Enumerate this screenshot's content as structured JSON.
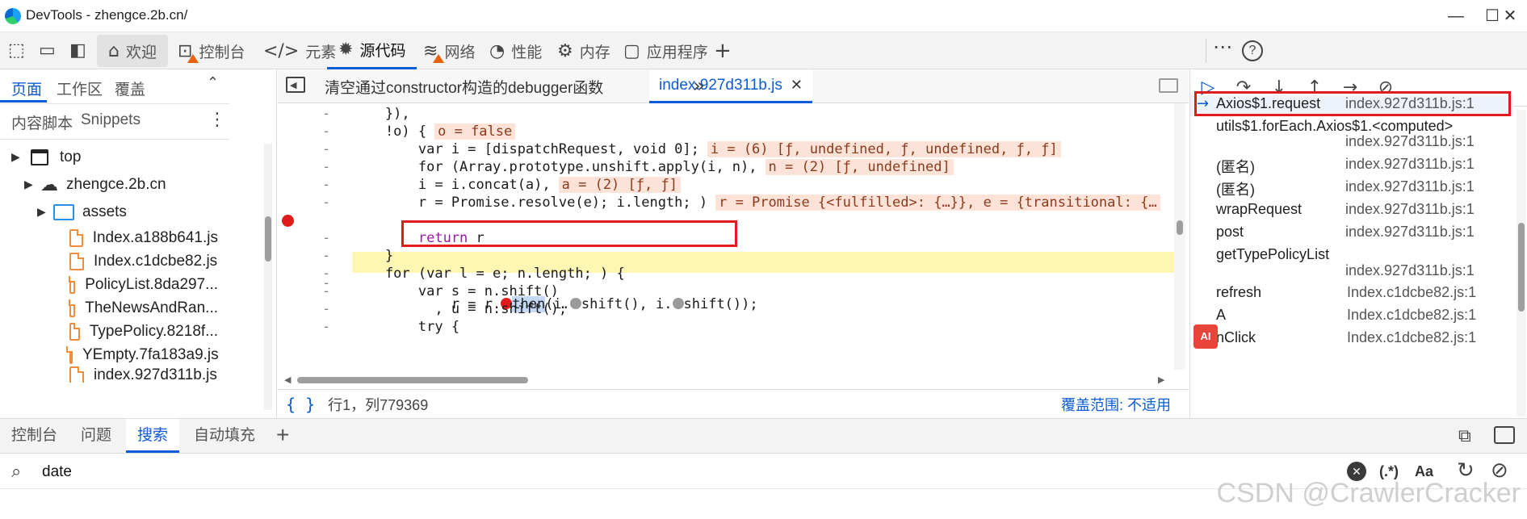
{
  "window": {
    "title": "DevTools - zhengce.2b.cn/",
    "minimize": "—",
    "maximize": "☐",
    "close": "✕"
  },
  "main_tabs": [
    {
      "label": "欢迎",
      "icon": "home-icon"
    },
    {
      "label": "控制台",
      "icon": "console-icon"
    },
    {
      "label": "元素",
      "icon": "elements-icon"
    },
    {
      "label": "源代码",
      "icon": "sources-icon"
    },
    {
      "label": "网络",
      "icon": "network-icon"
    },
    {
      "label": "性能",
      "icon": "performance-icon"
    },
    {
      "label": "内存",
      "icon": "memory-icon"
    },
    {
      "label": "应用程序",
      "icon": "application-icon"
    }
  ],
  "navigator": {
    "tabs": [
      "页面",
      "工作区",
      "覆盖"
    ],
    "subtabs": [
      "内容脚本",
      "Snippets"
    ],
    "tree": [
      {
        "label": "top",
        "kind": "frame"
      },
      {
        "label": "zhengce.2b.cn",
        "kind": "domain"
      },
      {
        "label": "assets",
        "kind": "folder"
      },
      {
        "label": "Index.a188b641.js",
        "kind": "file"
      },
      {
        "label": "Index.c1dcbe82.js",
        "kind": "file"
      },
      {
        "label": "PolicyList.8da297...",
        "kind": "file"
      },
      {
        "label": "TheNewsAndRan...",
        "kind": "file"
      },
      {
        "label": "TypePolicy.8218f...",
        "kind": "file"
      },
      {
        "label": "YEmpty.7fa183a9.js",
        "kind": "file"
      },
      {
        "label": "index.927d311b.js",
        "kind": "file"
      }
    ]
  },
  "editor": {
    "tabs": [
      "清空通过constructor构造的debugger函数",
      "index.927d311b.js"
    ],
    "status_position": "行1，列779369",
    "status_coverage": "覆盖范围: 不适用",
    "code_lines": [
      {
        "code": "    }),",
        "inline": ""
      },
      {
        "code": "    !o) {",
        "inline": "o = false"
      },
      {
        "code": "        var i = [dispatchRequest, void 0];",
        "inline": "i = (6) [ƒ, undefined, ƒ, undefined, ƒ, ƒ]"
      },
      {
        "code": "        for (Array.prototype.unshift.apply(i, n),",
        "inline": "n = (2) [ƒ, undefined]"
      },
      {
        "code": "        i = i.concat(a),",
        "inline": "a = (2) [ƒ, ƒ]"
      },
      {
        "code": "        r = Promise.resolve(e); i.length; )",
        "inline": "r = Promise {<fulfilled>: {…}}, e = {transitional: {…"
      },
      {
        "code": "",
        "inline": ""
      },
      {
        "code": "        return r",
        "inline": ""
      },
      {
        "code": "    }",
        "inline": ""
      },
      {
        "code": "    for (var l = e; n.length; ) {",
        "inline": ""
      },
      {
        "code": "        var s = n.shift()",
        "inline": ""
      },
      {
        "code": "          , u = n.shift();",
        "inline": ""
      },
      {
        "code": "        try {",
        "inline": ""
      }
    ],
    "current_line": {
      "indent": "            r = r.",
      "method": "then",
      "rest1": "(i.",
      "rest2": "shift(), i.",
      "rest3": "shift());"
    }
  },
  "call_stack": [
    {
      "fn": "Axios$1.request",
      "loc": "index.927d311b.js:1",
      "current": true
    },
    {
      "fn": "utils$1.forEach.Axios$1.<computed>",
      "loc": "index.927d311b.js:1"
    },
    {
      "fn": "(匿名)",
      "loc": "index.927d311b.js:1"
    },
    {
      "fn": "(匿名)",
      "loc": "index.927d311b.js:1"
    },
    {
      "fn": "wrapRequest",
      "loc": "index.927d311b.js:1"
    },
    {
      "fn": "post",
      "loc": "index.927d311b.js:1"
    },
    {
      "fn": "getTypePolicyList",
      "loc": "index.927d311b.js:1"
    },
    {
      "fn": "refresh",
      "loc": "Index.c1dcbe82.js:1"
    },
    {
      "fn": "A",
      "loc": "Index.c1dcbe82.js:1"
    },
    {
      "fn": "nClick",
      "loc": "Index.c1dcbe82.js:1"
    }
  ],
  "drawer": {
    "tabs": [
      "控制台",
      "问题",
      "搜索",
      "自动填充"
    ],
    "search_value": "date",
    "regex_label": "(.*)",
    "case_label": "Aa"
  },
  "watermark": "CSDN @CrawlerCracker"
}
